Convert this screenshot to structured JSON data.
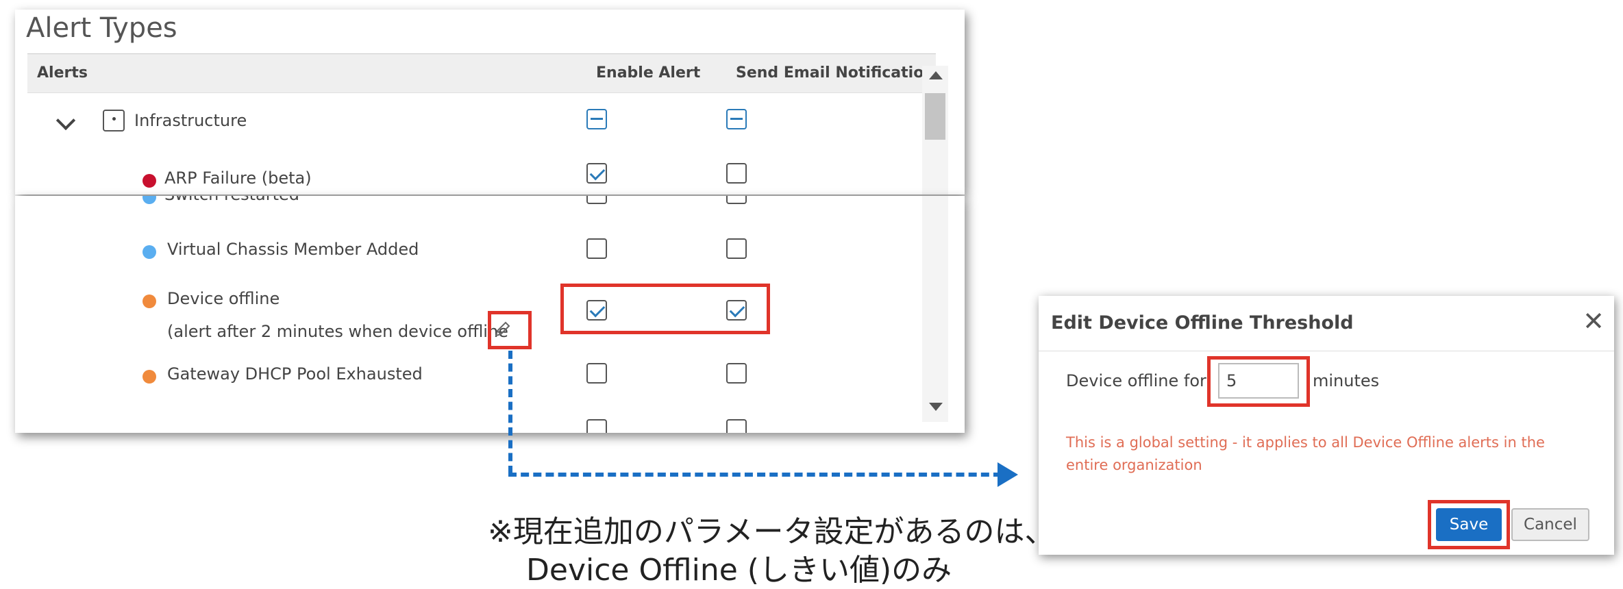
{
  "alert_types": {
    "title": "Alert Types",
    "columns": {
      "alerts": "Alerts",
      "enable_alert": "Enable Alert",
      "send_email": "Send Email Notification"
    },
    "group": {
      "label": "Infrastructure",
      "enable_state": "partial",
      "email_state": "partial"
    },
    "rows_top": [
      {
        "label": "ARP Failure (beta)",
        "color": "#c8102e",
        "enable": true,
        "email": false
      }
    ],
    "rows_bottom": [
      {
        "label": "Switch restarted",
        "color": "#5aaef0"
      },
      {
        "label": "Virtual Chassis Member Added",
        "color": "#5aaef0",
        "enable": false,
        "email": false
      },
      {
        "label": "Device offline",
        "sublabel": "(alert after 2 minutes when device offline",
        "color": "#f08a3c",
        "enable": true,
        "email": true
      },
      {
        "label": "Gateway DHCP Pool Exhausted",
        "color": "#f08a3c",
        "enable": false,
        "email": false
      }
    ]
  },
  "note": {
    "line1": "※現在追加のパラメータ設定があるのは、",
    "line2": "Device Offline (しきい値)のみ"
  },
  "dialog": {
    "title": "Edit Device Offline Threshold",
    "close": "✕",
    "label_before": "Device offline for",
    "input_value": "5",
    "label_after": "minutes",
    "warning": "This is a global setting - it applies to all Device Offline alerts in the entire organization",
    "save": "Save",
    "cancel": "Cancel"
  },
  "icons": {
    "edit": "pencil-icon",
    "collapse": "chevron-down-icon",
    "group": "group-icon"
  },
  "colors": {
    "accent": "#1a6fc4",
    "highlight": "#e0342a",
    "warning": "#e06d55"
  }
}
